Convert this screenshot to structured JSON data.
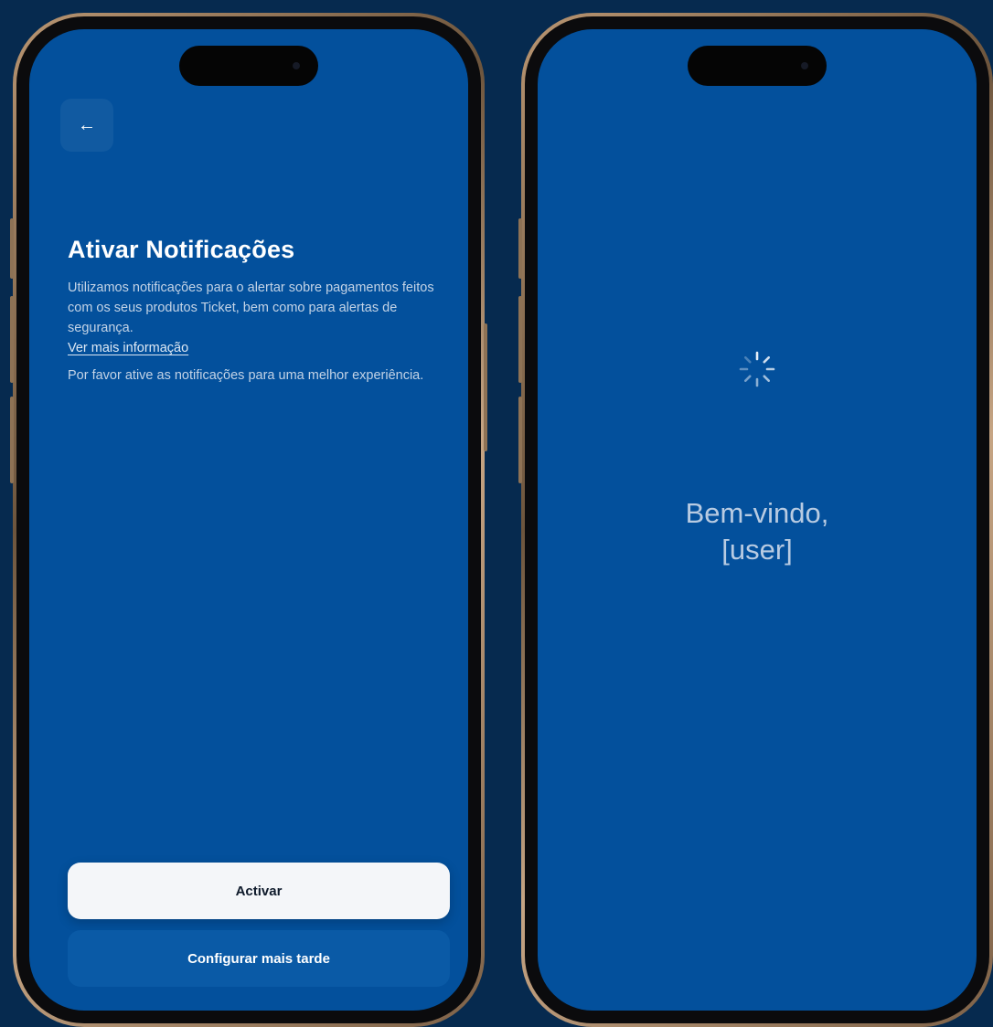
{
  "colors": {
    "background": "#062a4f",
    "screen": "#03509c",
    "primary_button": "#f4f6f9",
    "secondary_button": "#0a5aa6"
  },
  "notifications_screen": {
    "back_icon": "arrow-left-icon",
    "back_glyph": "←",
    "title": "Ativar Notificações",
    "description": "Utilizamos notificações para o alertar sobre pagamentos feitos com os seus produtos Ticket, bem como para alertas de segurança.",
    "more_info_link": "Ver mais informação",
    "prompt": "Por favor ative as notificações para uma melhor experiência.",
    "activate_button": "Activar",
    "later_button": "Configurar mais tarde"
  },
  "welcome_screen": {
    "spinner_icon": "loading-spinner-icon",
    "greeting": "Bem-vindo,",
    "user_placeholder": "[user]"
  }
}
